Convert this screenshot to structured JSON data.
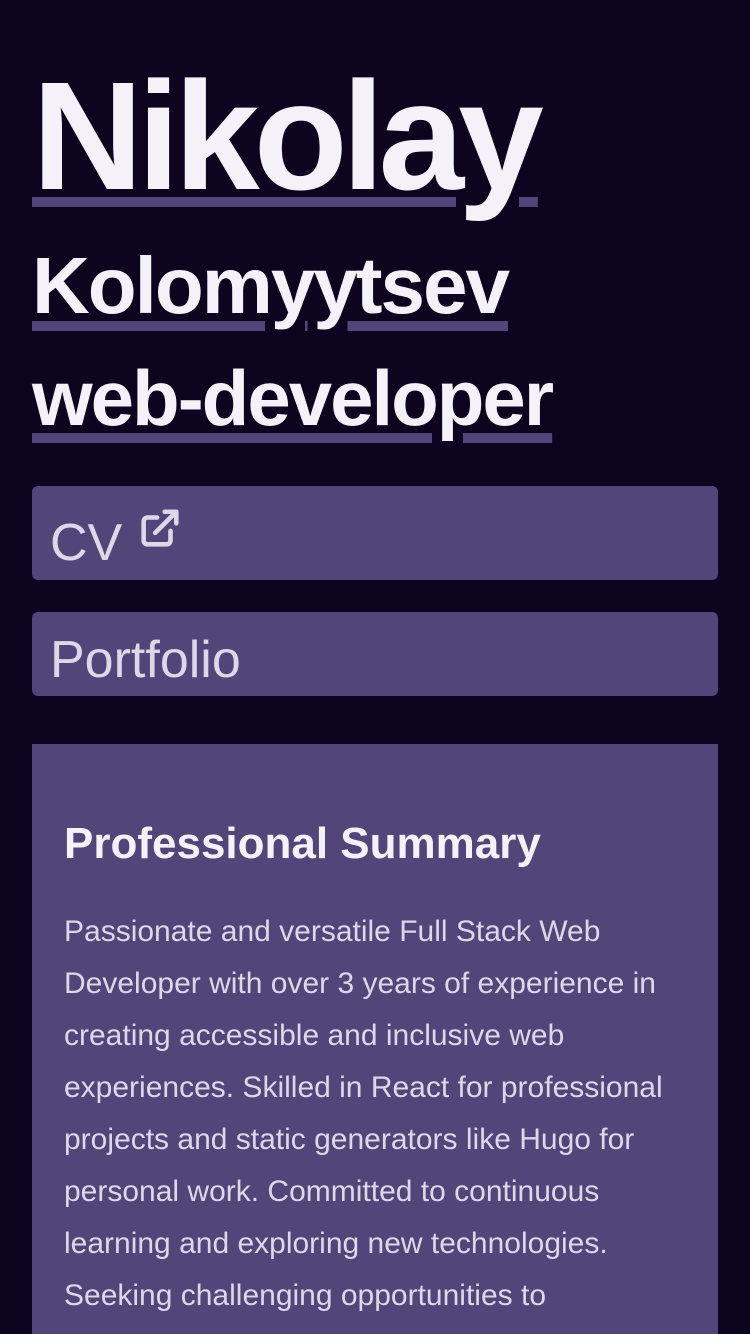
{
  "hero": {
    "first_name": "Nikolay",
    "last_name": "Kolomyytsev",
    "role": "web-developer"
  },
  "links": {
    "cv_label": "CV",
    "cv_icon": "external-link-icon",
    "portfolio_label": "Portfolio"
  },
  "summary": {
    "heading": "Professional Summary",
    "body": "Passionate and versatile Full Stack Web Developer with over 3 years of experience in creating accessible and inclusive web experiences. Skilled in React for professional projects and static generators like Hugo for personal work. Committed to continuous learning and exploring new technologies. Seeking challenging opportunities to contribute to innovative"
  },
  "colors": {
    "background": "#0d0420",
    "card": "#524579",
    "text": "#f4f2f8",
    "muted_text": "#ddd8e8"
  }
}
